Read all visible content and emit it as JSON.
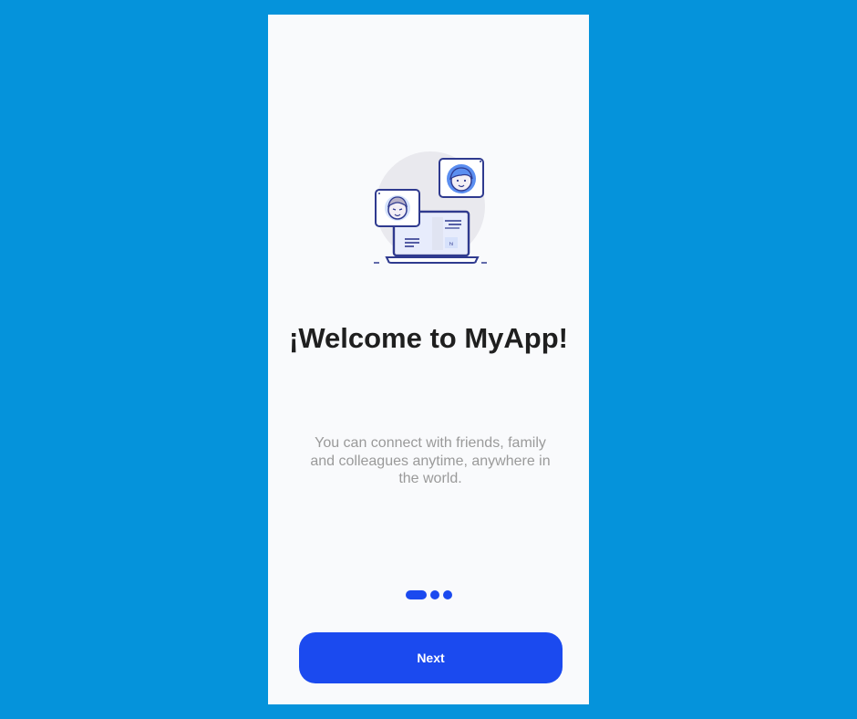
{
  "onboarding": {
    "title": "¡Welcome to MyApp!",
    "subtitle": "You can connect with friends, family and colleagues anytime, anywhere in the world.",
    "next_label": "Next",
    "illustration_badge": "hi",
    "page_indicator": {
      "current": 1,
      "total": 3
    }
  },
  "icons": {
    "illustration": "video-call-laptop-illustration",
    "male_avatar": "male-avatar-icon",
    "female_avatar": "female-avatar-icon"
  },
  "colors": {
    "background": "#0593DB",
    "screen": "#F9FAFC",
    "accent": "#1B4AEF",
    "title": "#1F1F1F",
    "subtitle": "#9A9A9A",
    "illustration_stroke": "#2F3A8F",
    "illustration_fill": "#5B8EF0"
  }
}
